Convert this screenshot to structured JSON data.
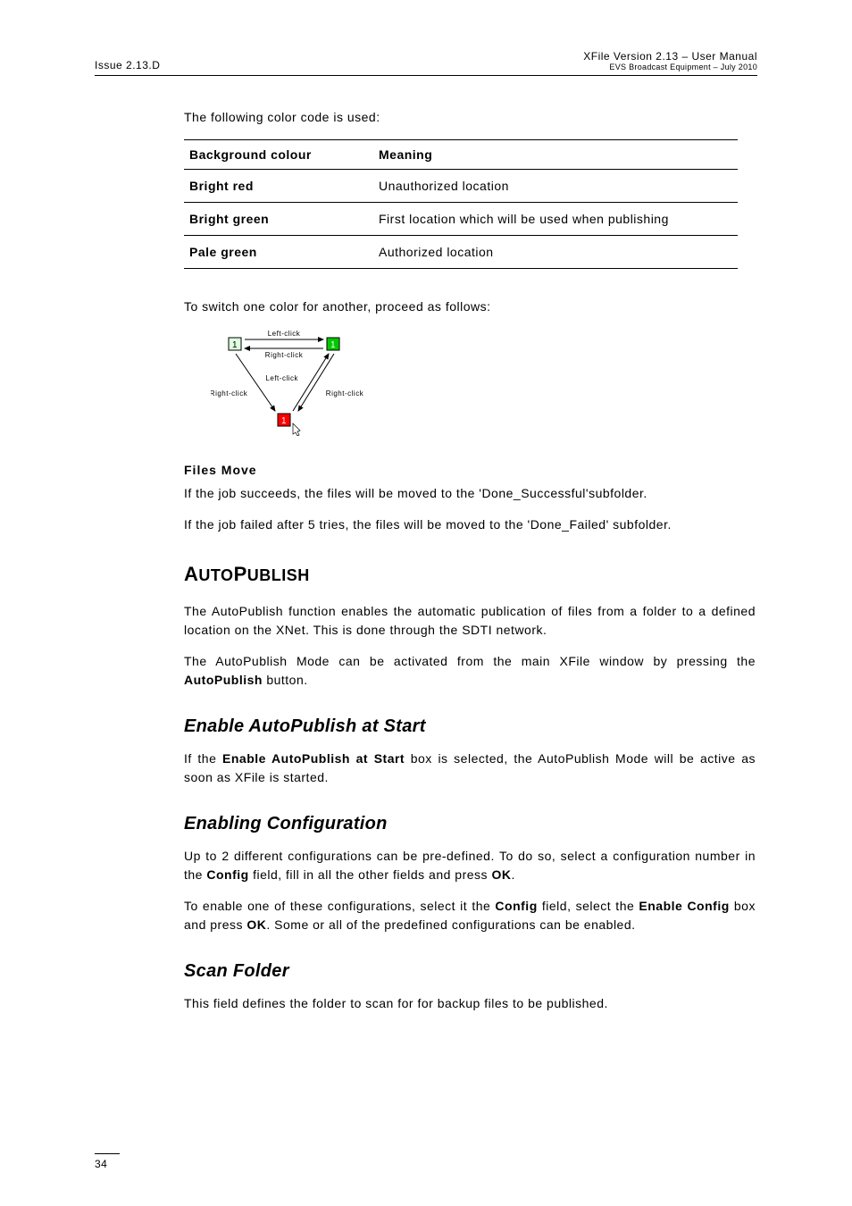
{
  "header": {
    "left": "Issue 2.13.D",
    "right_line1": "XFile Version 2.13 – User Manual",
    "right_line2": "EVS Broadcast Equipment – July 2010"
  },
  "intro_para": "The following color code is used:",
  "table": {
    "head_col1": "Background colour",
    "head_col2": "Meaning",
    "rows": [
      {
        "label": "Bright red",
        "meaning": "Unauthorized location"
      },
      {
        "label": "Bright green",
        "meaning": "First location which will be used when publishing"
      },
      {
        "label": "Pale green",
        "meaning": "Authorized location"
      }
    ]
  },
  "switch_para": "To switch one color for another, proceed as follows:",
  "diagram": {
    "box_label": "1",
    "left_click": "Left-click",
    "right_click": "Right-click"
  },
  "files_move": {
    "heading": "Files Move",
    "p1": "If the job succeeds, the files will be moved to the 'Done_Successful'subfolder.",
    "p2": "If the job failed after 5 tries, the files will be moved to the 'Done_Failed' subfolder."
  },
  "autopublish": {
    "heading_cap1": "A",
    "heading_rest1": "UTO",
    "heading_cap2": "P",
    "heading_rest2": "UBLISH",
    "p1": "The AutoPublish function enables the automatic publication of files from a folder to a defined location on the XNet. This is done through the SDTI network.",
    "p2_pre": "The AutoPublish Mode can be activated from the main XFile window by pressing the ",
    "p2_bold": "AutoPublish",
    "p2_post": " button."
  },
  "enable_start": {
    "heading": "Enable AutoPublish at Start",
    "p_pre": "If the ",
    "p_bold": "Enable AutoPublish at Start",
    "p_post": " box is selected, the AutoPublish Mode will be active as soon as XFile is started."
  },
  "enabling_config": {
    "heading": "Enabling Configuration",
    "p1_pre": "Up to 2 different configurations can be pre-defined. To do so, select a configuration number in the ",
    "p1_b1": "Config",
    "p1_mid": " field, fill in all the other fields and press ",
    "p1_b2": "OK",
    "p1_post": ".",
    "p2_pre": "To enable one of these configurations, select it the ",
    "p2_b1": "Config",
    "p2_mid1": " field, select the ",
    "p2_b2": "Enable Config",
    "p2_mid2": " box and press ",
    "p2_b3": "OK",
    "p2_post": ". Some or all of the predefined configurations can be enabled."
  },
  "scan_folder": {
    "heading": "Scan Folder",
    "p": "This field defines the folder to scan for for backup files to be published."
  },
  "page_number": "34"
}
